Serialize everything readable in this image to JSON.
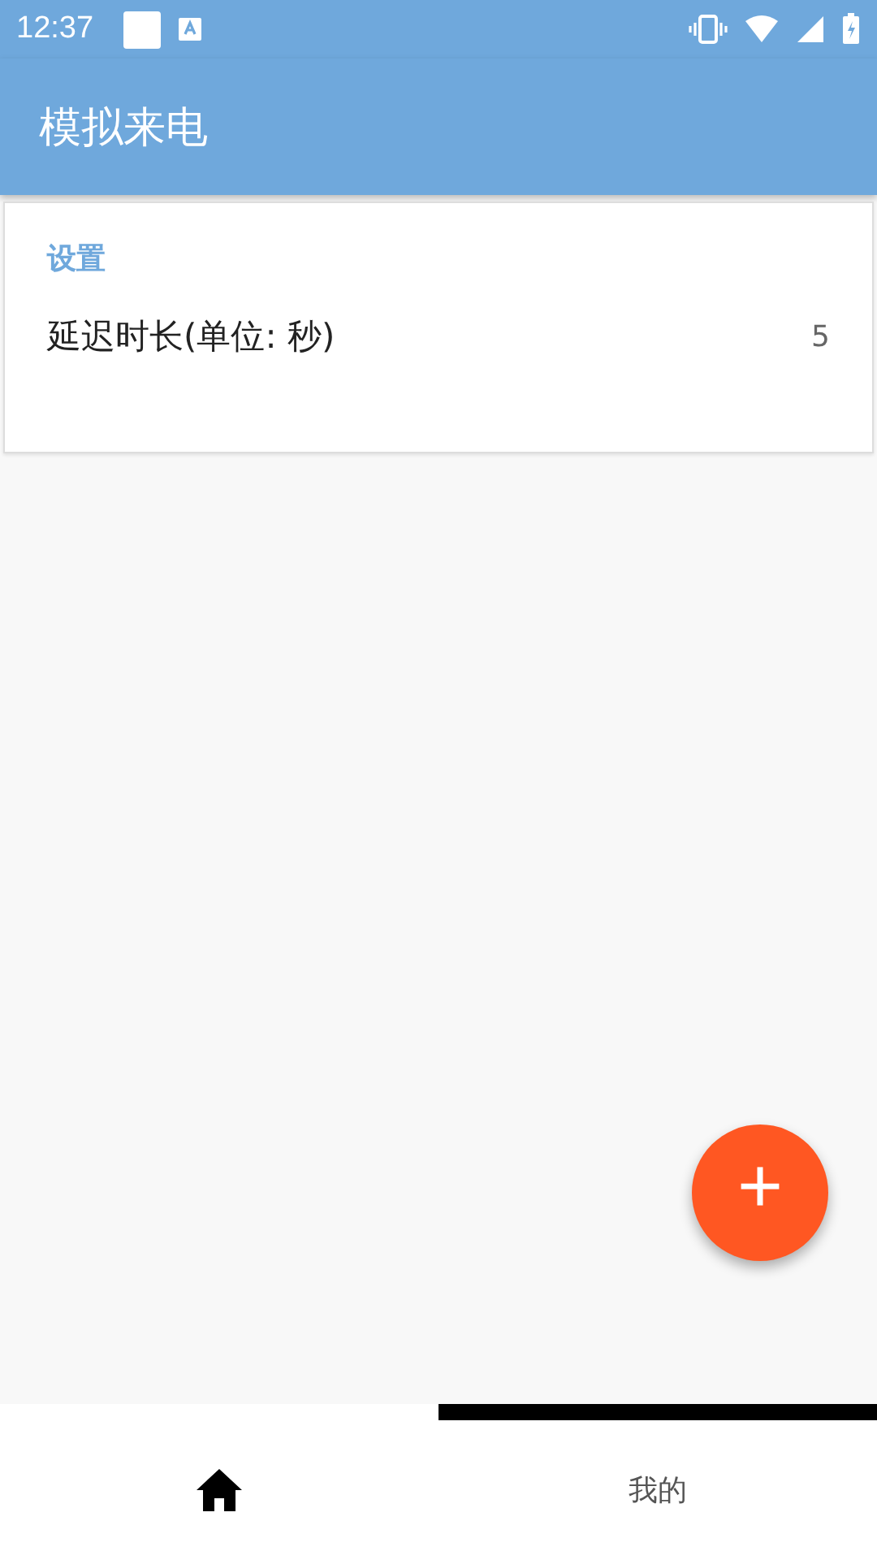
{
  "status_bar": {
    "time": "12:37"
  },
  "app_bar": {
    "title": "模拟来电"
  },
  "settings_card": {
    "header": "设置",
    "items": [
      {
        "label": "延迟时长(单位: 秒)",
        "value": "5"
      }
    ]
  },
  "fab": {
    "label": "+"
  },
  "bottom_nav": [
    {
      "kind": "icon",
      "selected": false
    },
    {
      "kind": "text",
      "label": "我的",
      "selected": true
    }
  ]
}
